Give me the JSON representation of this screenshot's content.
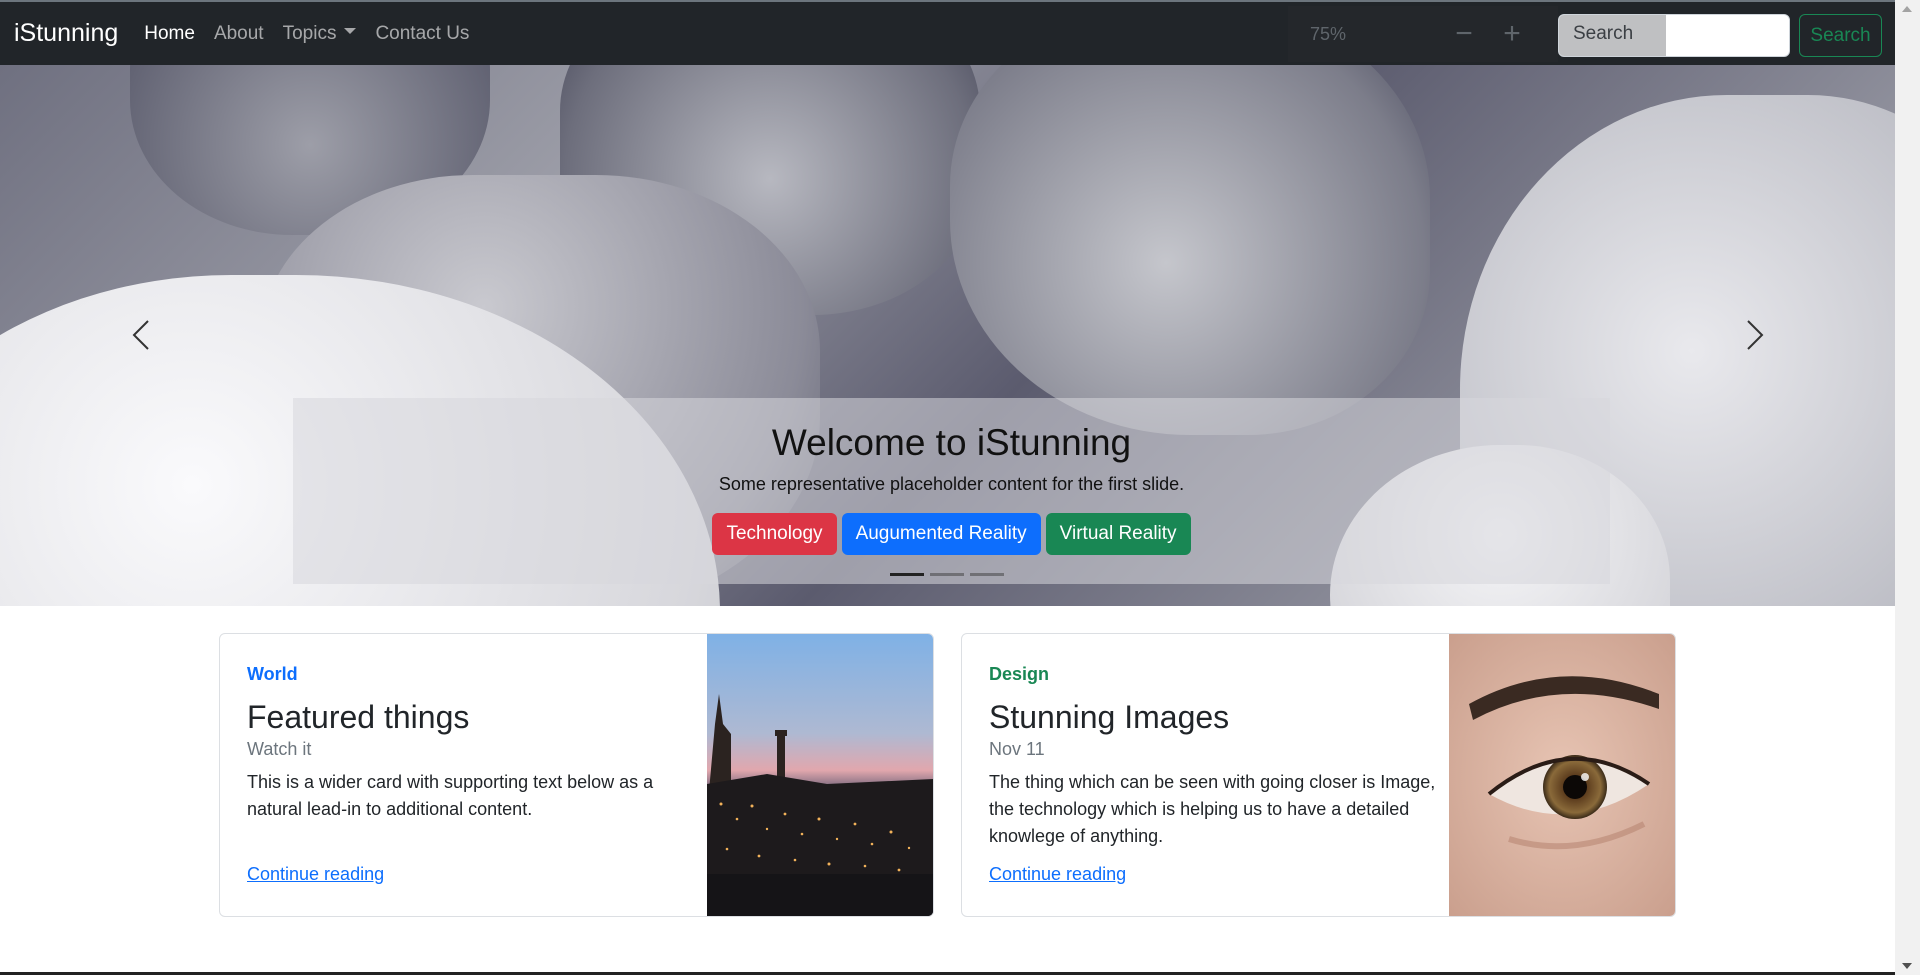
{
  "navbar": {
    "brand": "iStunning",
    "links": [
      {
        "label": "Home",
        "active": true
      },
      {
        "label": "About"
      },
      {
        "label": "Topics",
        "dropdown": true
      },
      {
        "label": "Contact Us"
      }
    ],
    "zoom": {
      "level": "75%",
      "minus": "−",
      "plus": "+"
    },
    "search": {
      "placeholder": "Search",
      "button_label": "Search"
    }
  },
  "carousel": {
    "title": "Welcome to iStunning",
    "subtitle": "Some representative placeholder content for the first slide.",
    "tags": [
      {
        "label": "Technology",
        "color": "#dc3545"
      },
      {
        "label": "Augumented Reality",
        "color": "#0d6efd"
      },
      {
        "label": "Virtual Reality",
        "color": "#198754"
      }
    ],
    "slides_count": 3,
    "active_slide": 1
  },
  "cards": [
    {
      "kicker": "World",
      "kicker_color": "#0d6efd",
      "title": "Featured things",
      "date": "Watch it",
      "text": "This is a wider card with supporting text below as a natural lead-in to additional content.",
      "link": "Continue reading"
    },
    {
      "kicker": "Design",
      "kicker_color": "#198754",
      "title": "Stunning Images",
      "date": "Nov 11",
      "text": "The thing which can be seen with going closer is Image, the technology which is helping us to have a detailed knowlege of anything.",
      "link": "Continue reading"
    }
  ]
}
